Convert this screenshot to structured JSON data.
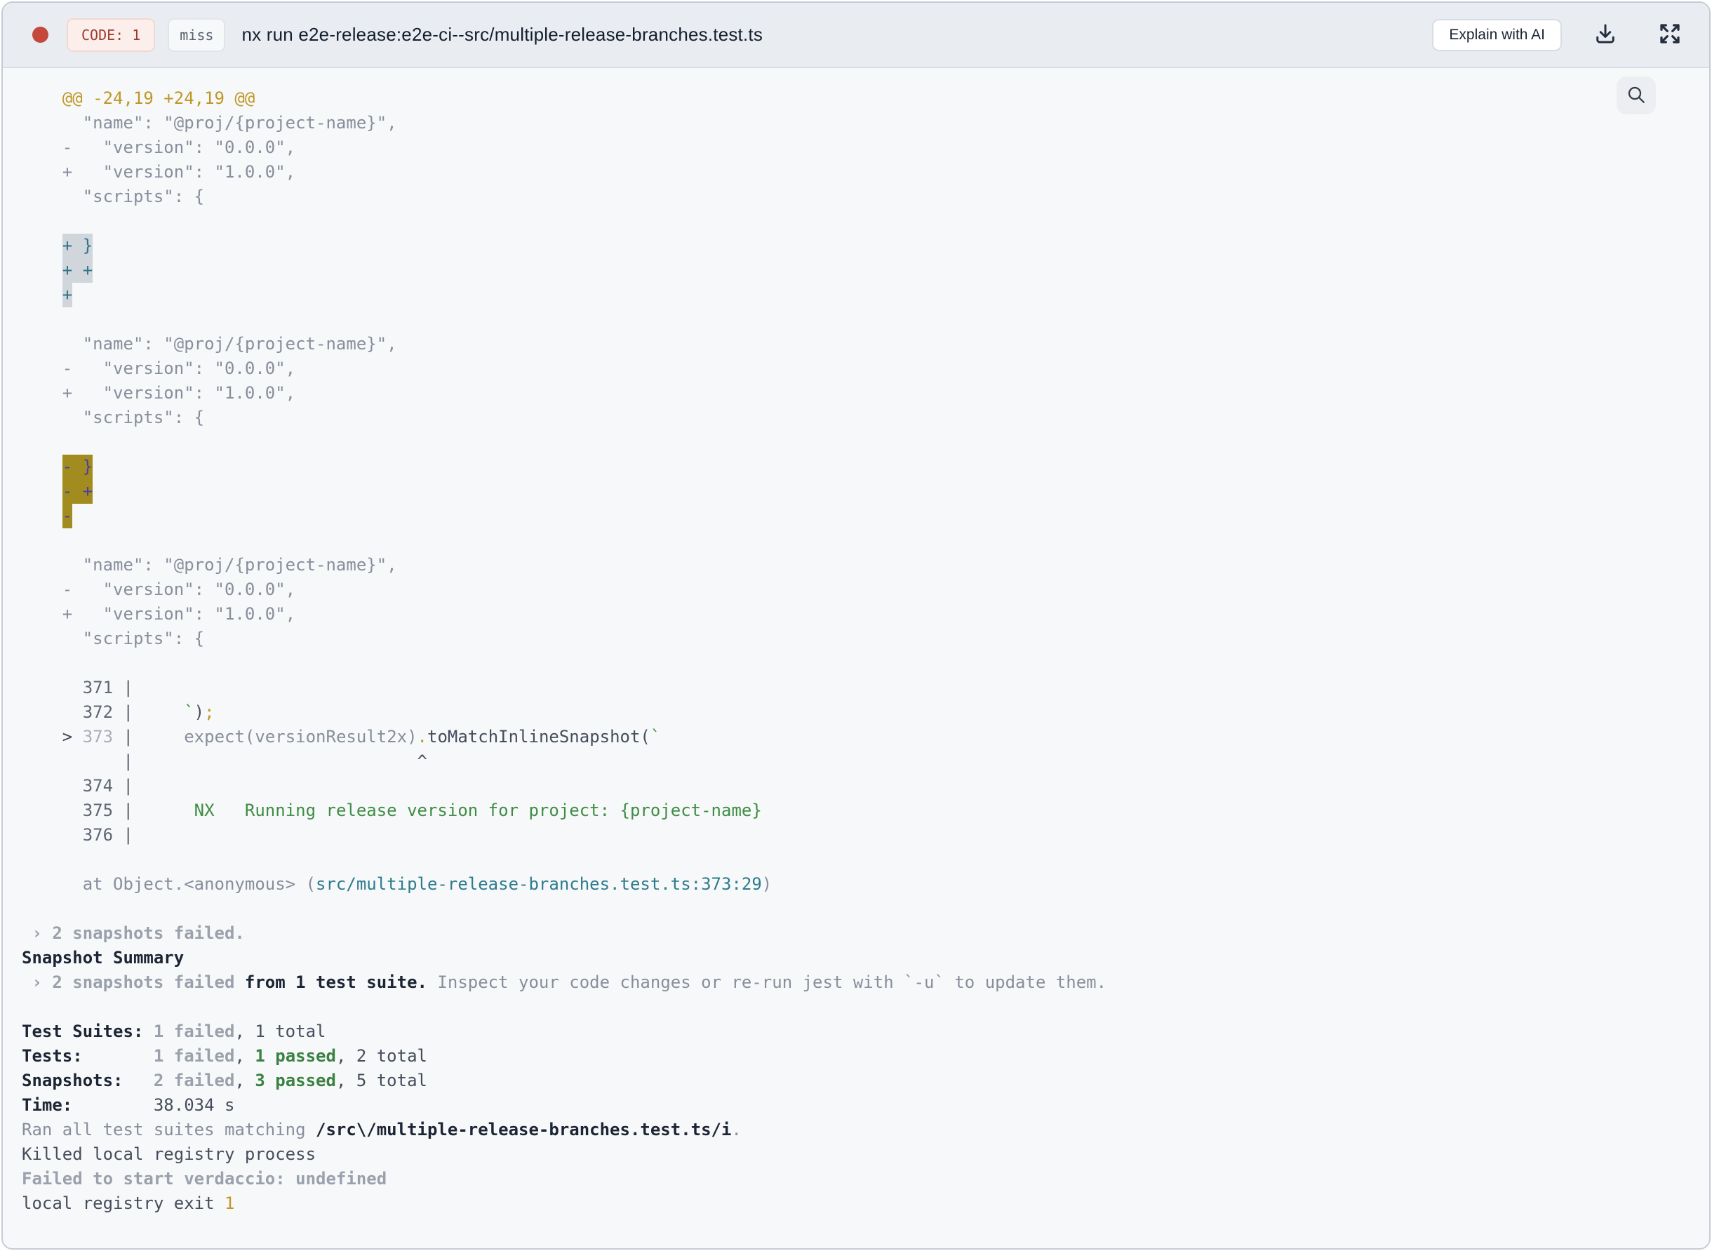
{
  "header": {
    "code_badge": "CODE: 1",
    "cache_badge": "miss",
    "title": "nx run e2e-release:e2e-ci--src/multiple-release-branches.test.ts",
    "explain_button": "Explain with AI"
  },
  "icons": {
    "status_dot": "red-circle",
    "download": "tray-arrow-down",
    "expand": "four-corner-expand-arrows",
    "search": "magnifying-glass"
  },
  "colors": {
    "card_border": "#c6ccd5",
    "header_bg": "#e9edf2",
    "content_bg": "#f7f8f9",
    "status_dot": "#c5483d",
    "code_badge_bg": "#fbeeeb",
    "code_badge_border": "#f3d8d2",
    "code_badge_text": "#9e3a2d",
    "miss_badge_bg": "#f6f8fa",
    "miss_badge_border": "#e1e5eb",
    "miss_badge_text": "#57606e",
    "title_text": "#141e2d",
    "term_gray": "#878e9c",
    "term_dark": "#454d5c",
    "term_bold_dark": "#1c2534",
    "term_bold_gray": "#9aa1ac",
    "term_yellow": "#bf9726",
    "term_green": "#3f8d44",
    "term_teal": "#2e7b8e",
    "sel_gray_bg": "#d1d6dc",
    "sel_gray_text": "#30758a",
    "sel_olive_bg": "#a28c1f",
    "sel_olive_text": "#4d3f9e"
  },
  "terminal": {
    "lines": [
      [
        {
          "t": "    @@ -24,19 +24,19 @@",
          "c": "y"
        }
      ],
      [
        {
          "t": "      \"name\": \"@proj/{project-name}\",",
          "c": "g"
        }
      ],
      [
        {
          "t": "    -   \"version\": \"0.0.0\",",
          "c": "g"
        }
      ],
      [
        {
          "t": "    +   \"version\": \"1.0.0\",",
          "c": "g"
        }
      ],
      [
        {
          "t": "      \"scripts\": {",
          "c": "g"
        }
      ],
      [],
      [
        {
          "t": "    ",
          "c": "g"
        },
        {
          "t": "+ }",
          "c": "s1"
        }
      ],
      [
        {
          "t": "    ",
          "c": "g"
        },
        {
          "t": "+ +",
          "c": "s1"
        }
      ],
      [
        {
          "t": "    ",
          "c": "g"
        },
        {
          "t": "+",
          "c": "s1"
        }
      ],
      [],
      [
        {
          "t": "      \"name\": \"@proj/{project-name}\",",
          "c": "g"
        }
      ],
      [
        {
          "t": "    -   \"version\": \"0.0.0\",",
          "c": "g"
        }
      ],
      [
        {
          "t": "    +   \"version\": \"1.0.0\",",
          "c": "g"
        }
      ],
      [
        {
          "t": "      \"scripts\": {",
          "c": "g"
        }
      ],
      [],
      [
        {
          "t": "    ",
          "c": "g"
        },
        {
          "t": "- }",
          "c": "s2"
        }
      ],
      [
        {
          "t": "    ",
          "c": "g"
        },
        {
          "t": "- +",
          "c": "s2"
        }
      ],
      [
        {
          "t": "    ",
          "c": "g"
        },
        {
          "t": "-",
          "c": "s2"
        }
      ],
      [],
      [
        {
          "t": "      \"name\": \"@proj/{project-name}\",",
          "c": "g"
        }
      ],
      [
        {
          "t": "    -   \"version\": \"0.0.0\",",
          "c": "g"
        }
      ],
      [
        {
          "t": "    +   \"version\": \"1.0.0\",",
          "c": "g"
        }
      ],
      [
        {
          "t": "      \"scripts\": {",
          "c": "g"
        }
      ],
      [],
      [
        {
          "t": "      371 |",
          "c": "num"
        }
      ],
      [
        {
          "t": "      372 |",
          "c": "num"
        },
        {
          "t": "     ",
          "c": "d"
        },
        {
          "t": "`",
          "c": "grn"
        },
        {
          "t": ")",
          "c": "d"
        },
        {
          "t": ";",
          "c": "y"
        }
      ],
      [
        {
          "t": "    > ",
          "c": "d"
        },
        {
          "t": "373",
          "c": "nlt"
        },
        {
          "t": " |",
          "c": "num"
        },
        {
          "t": "     expect(versionResult2x)",
          "c": "g"
        },
        {
          "t": ".",
          "c": "y"
        },
        {
          "t": "toMatchInlineSnapshot(",
          "c": "d"
        },
        {
          "t": "`",
          "c": "grn"
        }
      ],
      [
        {
          "t": "          |",
          "c": "num"
        },
        {
          "t": "                            ^",
          "c": "d"
        }
      ],
      [
        {
          "t": "      374 |",
          "c": "num"
        }
      ],
      [
        {
          "t": "      375 |",
          "c": "num"
        },
        {
          "t": "      NX   Running release version for project: {project-name}",
          "c": "grn"
        }
      ],
      [
        {
          "t": "      376 |",
          "c": "num"
        }
      ],
      [],
      [
        {
          "t": "      at Object.<anonymous> (",
          "c": "g"
        },
        {
          "t": "src/multiple-release-branches.test.ts:373:29",
          "c": "teal"
        },
        {
          "t": ")",
          "c": "g"
        }
      ],
      [],
      [
        {
          "t": " › 2 snapshots failed.",
          "c": "bg"
        }
      ],
      [
        {
          "t": "Snapshot Summary",
          "c": "bd"
        }
      ],
      [
        {
          "t": " › 2 snapshots failed",
          "c": "bg"
        },
        {
          "t": " from 1 test suite.",
          "c": "bd"
        },
        {
          "t": " Inspect your code changes or re-run jest with `-u` to update them.",
          "c": "g"
        }
      ],
      [],
      [
        {
          "t": "Test Suites: ",
          "c": "bd"
        },
        {
          "t": "1 failed",
          "c": "bg"
        },
        {
          "t": ", 1 total",
          "c": "d"
        }
      ],
      [
        {
          "t": "Tests:       ",
          "c": "bd"
        },
        {
          "t": "1 failed",
          "c": "bg"
        },
        {
          "t": ", ",
          "c": "d"
        },
        {
          "t": "1 passed",
          "c": "bgrn"
        },
        {
          "t": ", 2 total",
          "c": "d"
        }
      ],
      [
        {
          "t": "Snapshots:   ",
          "c": "bd"
        },
        {
          "t": "2 failed",
          "c": "bg"
        },
        {
          "t": ", ",
          "c": "d"
        },
        {
          "t": "3 passed",
          "c": "bgrn"
        },
        {
          "t": ", 5 total",
          "c": "d"
        }
      ],
      [
        {
          "t": "Time:        ",
          "c": "bd"
        },
        {
          "t": "38.034 s",
          "c": "d"
        }
      ],
      [
        {
          "t": "Ran all test suites matching ",
          "c": "g"
        },
        {
          "t": "/src\\/multiple-release-branches.test.ts/i",
          "c": "bd"
        },
        {
          "t": ".",
          "c": "g"
        }
      ],
      [
        {
          "t": "Killed local registry process",
          "c": "d"
        }
      ],
      [
        {
          "t": "Failed to start verdaccio: undefined",
          "c": "bg"
        }
      ],
      [
        {
          "t": "local registry exit ",
          "c": "d"
        },
        {
          "t": "1",
          "c": "y"
        }
      ]
    ]
  }
}
